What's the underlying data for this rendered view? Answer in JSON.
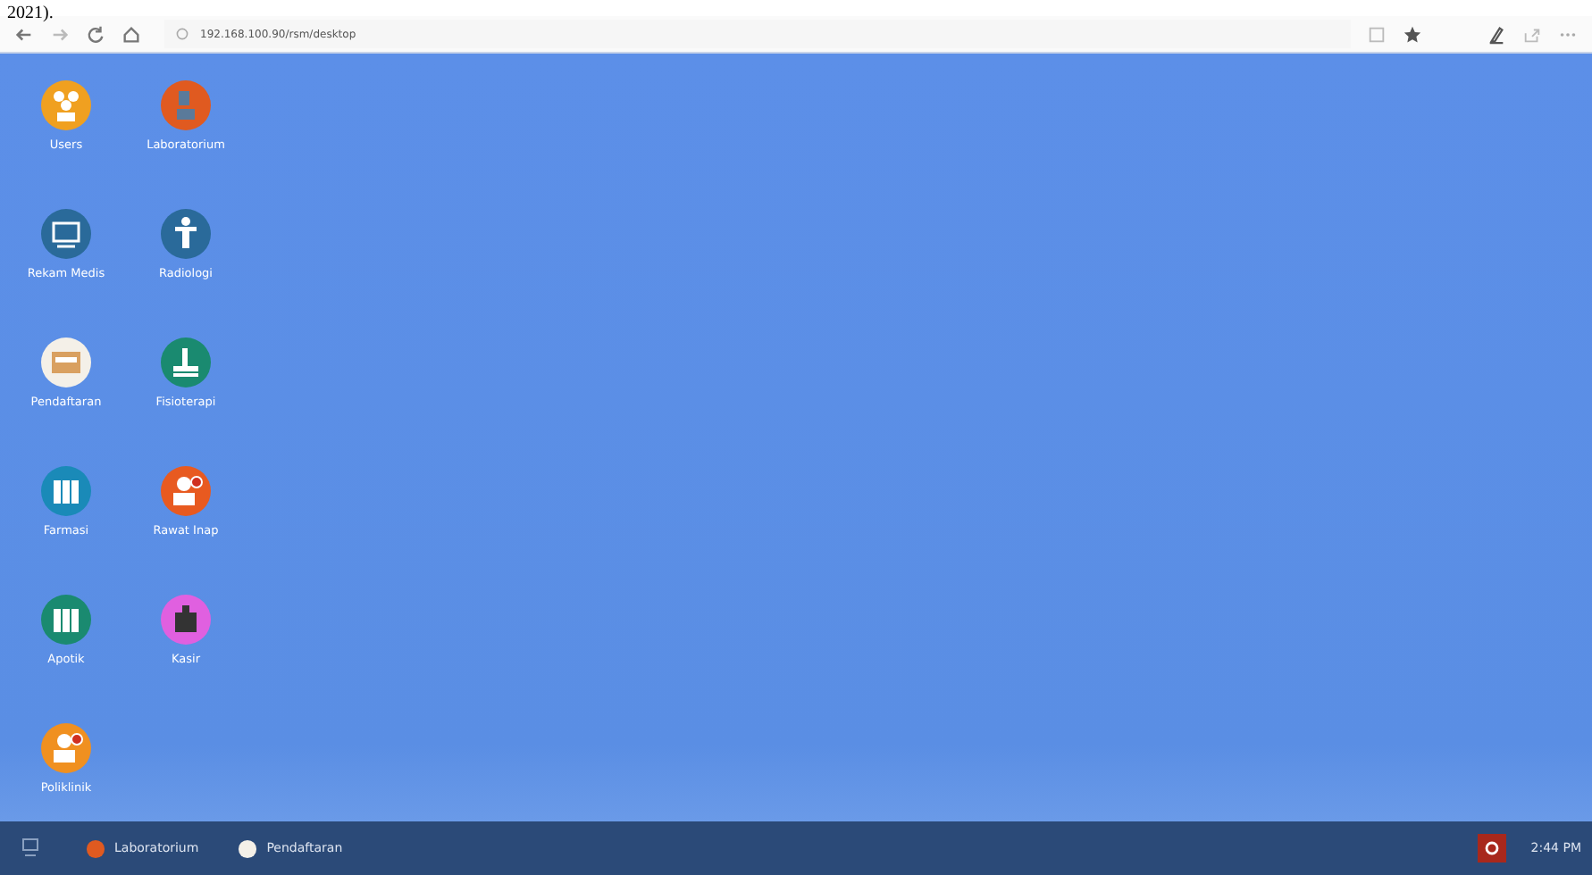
{
  "caption_fragment": "2021).",
  "browser": {
    "url": "192.168.100.90/rsm/desktop"
  },
  "desktop_icons": [
    {
      "label": "Users",
      "color": "#f0a020",
      "kind": "users"
    },
    {
      "label": "Rekam Medis",
      "color": "#2a6a9a",
      "kind": "monitor"
    },
    {
      "label": "Pendaftaran",
      "color": "#f4f0e8",
      "kind": "card"
    },
    {
      "label": "Farmasi",
      "color": "#1a8ab8",
      "kind": "bottles"
    },
    {
      "label": "Apotik",
      "color": "#1a8a70",
      "kind": "bottles"
    },
    {
      "label": "Poliklinik",
      "color": "#f09020",
      "kind": "person"
    },
    {
      "label": "Laboratorium",
      "color": "#e05a20",
      "kind": "microscope"
    },
    {
      "label": "Radiologi",
      "color": "#2a6a9a",
      "kind": "xray"
    },
    {
      "label": "Fisioterapi",
      "color": "#1a8a70",
      "kind": "bed"
    },
    {
      "label": "Rawat Inap",
      "color": "#e85a20",
      "kind": "person"
    },
    {
      "label": "Kasir",
      "color": "#e060e0",
      "kind": "register"
    }
  ],
  "taskbar": {
    "items": [
      {
        "label": "Laboratorium",
        "color": "#e05a20"
      },
      {
        "label": "Pendaftaran",
        "color": "#f4f0e8"
      }
    ],
    "clock": "2:44 PM"
  }
}
